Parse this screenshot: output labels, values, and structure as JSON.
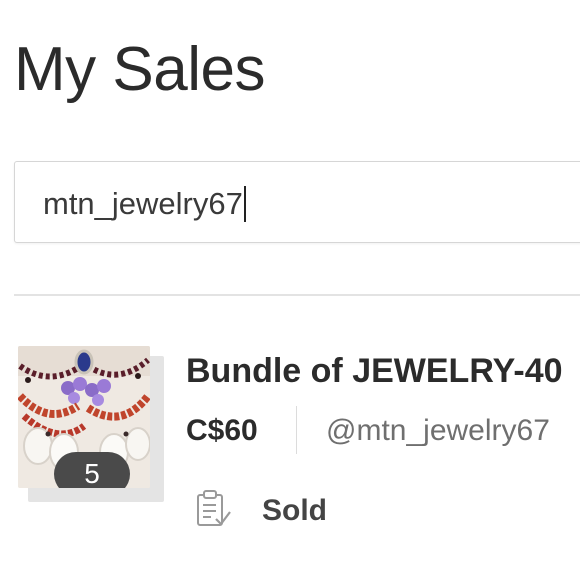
{
  "page": {
    "title": "My Sales"
  },
  "search": {
    "value": "mtn_jewelry67"
  },
  "listing": {
    "title": "Bundle of JEWELRY-40",
    "price": "C$60",
    "seller": "@mtn_jewelry67",
    "photo_count": "5",
    "status": "Sold",
    "status_icon": "clipboard-check-icon"
  }
}
